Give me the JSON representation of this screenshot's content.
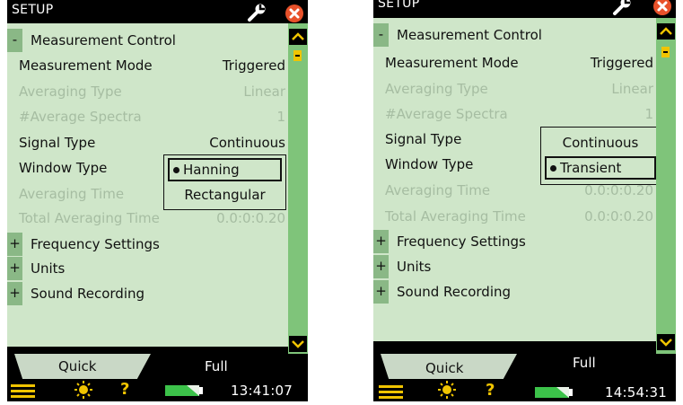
{
  "screens": [
    {
      "title": "SETUP",
      "sections": [
        {
          "toggle": "-",
          "label": "Measurement Control"
        },
        {
          "toggle": "+",
          "label": "Frequency Settings"
        },
        {
          "toggle": "+",
          "label": "Units"
        },
        {
          "toggle": "+",
          "label": "Sound Recording"
        }
      ],
      "rows": [
        {
          "label": "Measurement Mode",
          "value": "Triggered",
          "enabled": true
        },
        {
          "label": "Averaging Type",
          "value": "Linear",
          "enabled": false
        },
        {
          "label": "#Average Spectra",
          "value": "1",
          "enabled": false
        },
        {
          "label": "Signal Type",
          "value": "Continuous",
          "enabled": true
        },
        {
          "label": "Window Type",
          "value": "",
          "enabled": true
        },
        {
          "label": "Averaging Time",
          "value": "",
          "enabled": false
        },
        {
          "label": "Total Averaging Time",
          "value": "0.0:0:0.20",
          "enabled": false
        }
      ],
      "popup": {
        "field": "Window Type",
        "options": [
          "Hanning",
          "Rectangular"
        ],
        "selected": "Hanning"
      },
      "tabs": {
        "quick": "Quick",
        "full": "Full"
      },
      "status": {
        "time": "13:41:07"
      }
    },
    {
      "title": "SETUP",
      "sections": [
        {
          "toggle": "-",
          "label": "Measurement Control"
        },
        {
          "toggle": "+",
          "label": "Frequency Settings"
        },
        {
          "toggle": "+",
          "label": "Units"
        },
        {
          "toggle": "+",
          "label": "Sound Recording"
        }
      ],
      "rows": [
        {
          "label": "Measurement Mode",
          "value": "Triggered",
          "enabled": true
        },
        {
          "label": "Averaging Type",
          "value": "Linear",
          "enabled": false
        },
        {
          "label": "#Average Spectra",
          "value": "1",
          "enabled": false
        },
        {
          "label": "Signal Type",
          "value": "",
          "enabled": true
        },
        {
          "label": "Window Type",
          "value": "",
          "enabled": true
        },
        {
          "label": "Averaging Time",
          "value": "0.0:0:0.20",
          "enabled": false
        },
        {
          "label": "Total Averaging Time",
          "value": "0.0:0:0.20",
          "enabled": false
        }
      ],
      "popup": {
        "field": "Signal Type",
        "options": [
          "Continuous",
          "Transient"
        ],
        "selected": "Transient"
      },
      "tabs": {
        "quick": "Quick",
        "full": "Full"
      },
      "status": {
        "time": "14:54:31"
      }
    }
  ],
  "colors": {
    "panel": "#cfe6c9",
    "section_box": "#8ab886",
    "disabled_text": "#a6bda2",
    "scrollbar": "#7fc47a",
    "close": "#e8512a",
    "battery": "#3cc24a"
  },
  "icons": [
    "wrench-icon",
    "close-icon",
    "menu-icon",
    "backlight-icon",
    "help-icon",
    "battery-icon",
    "scroll-up-icon",
    "scroll-down-icon"
  ]
}
